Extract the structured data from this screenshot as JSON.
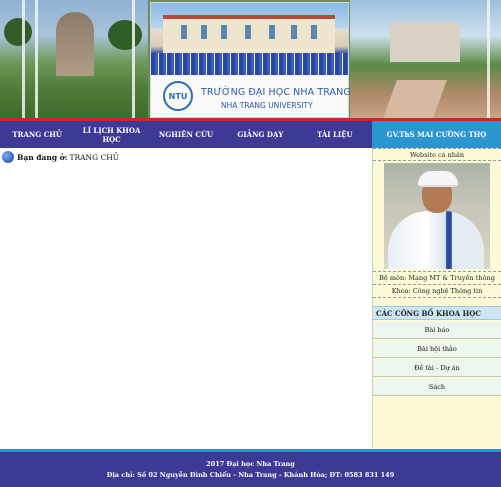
{
  "header": {
    "university_vn": "TRƯỜNG ĐẠI HỌC NHA TRANG",
    "university_en": "NHA TRANG UNIVERSITY",
    "logo_text": "NTU"
  },
  "nav": {
    "items": [
      "TRANG CHỦ",
      "LÍ LỊCH KHOA HỌC",
      "NGHIÊN CỨU",
      "GIẢNG DẠY",
      "TÀI LIỆU"
    ],
    "profile_tab": "GV.ThS MAI CƯỜNG THỌ"
  },
  "breadcrumb": {
    "label": "Bạn đang ở:",
    "current": "TRANG CHỦ"
  },
  "sidebar": {
    "website_label": "Website cá nhân",
    "department": "Bộ môn: Mạng MT & Truyền thông",
    "faculty": "Khoa: Công nghệ Thông tin",
    "publications_header": "CÁC CÔNG BỐ KHOA HỌC",
    "publications": [
      "Bài báo",
      "Bài hội thảo",
      "Đề tài - Dự án",
      "Sách"
    ]
  },
  "footer": {
    "line1": "2017 Đại học Nha Trang",
    "line2": "Địa chỉ: Số 02 Nguyễn Đình Chiểu - Nha Trang - Khánh Hòa; ĐT: 0583 831 149"
  },
  "colors": {
    "nav_bg": "#3d3a96",
    "accent_blue": "#2a95cf",
    "red_line": "#c9262d",
    "sidebar_bg": "#fdfbd7"
  }
}
